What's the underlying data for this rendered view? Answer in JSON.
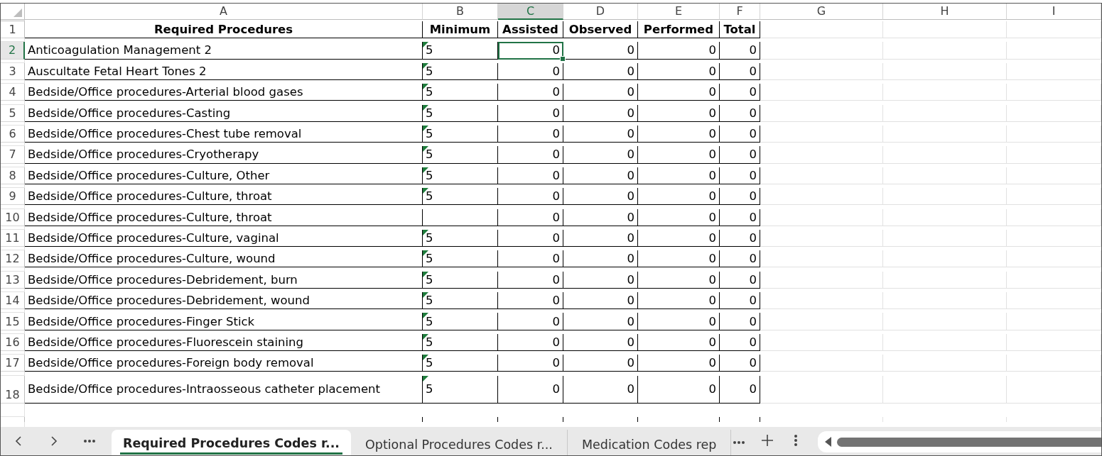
{
  "columns": [
    {
      "letter": "A",
      "selected": false
    },
    {
      "letter": "B",
      "selected": false
    },
    {
      "letter": "C",
      "selected": true
    },
    {
      "letter": "D",
      "selected": false
    },
    {
      "letter": "E",
      "selected": false
    },
    {
      "letter": "F",
      "selected": false
    },
    {
      "letter": "G",
      "selected": false
    },
    {
      "letter": "H",
      "selected": false
    },
    {
      "letter": "I",
      "selected": false
    }
  ],
  "header_row": {
    "number": "1",
    "cells": [
      "Required Procedures",
      "Minimum",
      "Assisted",
      "Observed",
      "Performed",
      "Total"
    ]
  },
  "rows": [
    {
      "number": "2",
      "selected": true,
      "tall": false,
      "procedure": "Anticoagulation Management 2",
      "minimum": "5",
      "flagged": true,
      "assisted": "0",
      "observed": "0",
      "performed": "0",
      "total": "0"
    },
    {
      "number": "3",
      "selected": false,
      "tall": false,
      "procedure": "Auscultate Fetal Heart Tones 2",
      "minimum": "5",
      "flagged": true,
      "assisted": "0",
      "observed": "0",
      "performed": "0",
      "total": "0"
    },
    {
      "number": "4",
      "selected": false,
      "tall": false,
      "procedure": "Bedside/Office procedures-Arterial blood gases",
      "minimum": "5",
      "flagged": true,
      "assisted": "0",
      "observed": "0",
      "performed": "0",
      "total": "0"
    },
    {
      "number": "5",
      "selected": false,
      "tall": false,
      "procedure": "Bedside/Office procedures-Casting",
      "minimum": "5",
      "flagged": true,
      "assisted": "0",
      "observed": "0",
      "performed": "0",
      "total": "0"
    },
    {
      "number": "6",
      "selected": false,
      "tall": false,
      "procedure": "Bedside/Office procedures-Chest tube removal",
      "minimum": "5",
      "flagged": true,
      "assisted": "0",
      "observed": "0",
      "performed": "0",
      "total": "0"
    },
    {
      "number": "7",
      "selected": false,
      "tall": false,
      "procedure": "Bedside/Office procedures-Cryotherapy",
      "minimum": "5",
      "flagged": true,
      "assisted": "0",
      "observed": "0",
      "performed": "0",
      "total": "0"
    },
    {
      "number": "8",
      "selected": false,
      "tall": false,
      "procedure": "Bedside/Office procedures-Culture, Other",
      "minimum": "5",
      "flagged": true,
      "assisted": "0",
      "observed": "0",
      "performed": "0",
      "total": "0"
    },
    {
      "number": "9",
      "selected": false,
      "tall": false,
      "procedure": "Bedside/Office procedures-Culture, throat",
      "minimum": "5",
      "flagged": true,
      "assisted": "0",
      "observed": "0",
      "performed": "0",
      "total": "0"
    },
    {
      "number": "10",
      "selected": false,
      "tall": false,
      "procedure": "Bedside/Office procedures-Culture, throat",
      "flagged": false,
      "assisted": "0",
      "observed": "0",
      "performed": "0",
      "total": "0"
    },
    {
      "number": "11",
      "selected": false,
      "tall": false,
      "procedure": "Bedside/Office procedures-Culture, vaginal",
      "minimum": "5",
      "flagged": true,
      "assisted": "0",
      "observed": "0",
      "performed": "0",
      "total": "0"
    },
    {
      "number": "12",
      "selected": false,
      "tall": false,
      "procedure": "Bedside/Office procedures-Culture, wound",
      "minimum": "5",
      "flagged": true,
      "assisted": "0",
      "observed": "0",
      "performed": "0",
      "total": "0"
    },
    {
      "number": "13",
      "selected": false,
      "tall": false,
      "procedure": "Bedside/Office procedures-Debridement, burn",
      "minimum": "5",
      "flagged": true,
      "assisted": "0",
      "observed": "0",
      "performed": "0",
      "total": "0"
    },
    {
      "number": "14",
      "selected": false,
      "tall": false,
      "procedure": "Bedside/Office procedures-Debridement, wound",
      "minimum": "5",
      "flagged": true,
      "assisted": "0",
      "observed": "0",
      "performed": "0",
      "total": "0"
    },
    {
      "number": "15",
      "selected": false,
      "tall": false,
      "procedure": "Bedside/Office procedures-Finger Stick",
      "minimum": "5",
      "flagged": true,
      "assisted": "0",
      "observed": "0",
      "performed": "0",
      "total": "0"
    },
    {
      "number": "16",
      "selected": false,
      "tall": false,
      "procedure": "Bedside/Office procedures-Fluorescein staining",
      "minimum": "5",
      "flagged": true,
      "assisted": "0",
      "observed": "0",
      "performed": "0",
      "total": "0"
    },
    {
      "number": "17",
      "selected": false,
      "tall": false,
      "procedure": "Bedside/Office procedures-Foreign body removal",
      "minimum": "5",
      "flagged": true,
      "assisted": "0",
      "observed": "0",
      "performed": "0",
      "total": "0"
    },
    {
      "number": "18",
      "selected": false,
      "tall": true,
      "procedure": "Bedside/Office procedures-Intraosseous catheter placement",
      "minimum": "5",
      "flagged": true,
      "assisted": "0",
      "observed": "0",
      "performed": "0",
      "total": "0"
    }
  ],
  "sheet_tabs": [
    {
      "label": "Required Procedures Codes r...",
      "selected": true
    },
    {
      "label": "Optional Procedures Codes r...",
      "selected": false
    },
    {
      "label": "Medication Codes rep",
      "selected": false
    }
  ]
}
